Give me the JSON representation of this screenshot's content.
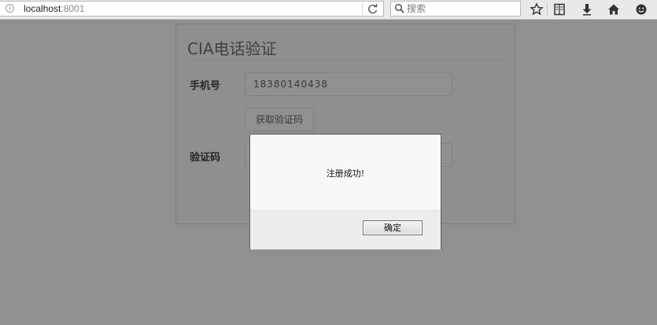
{
  "browser": {
    "url_host": "localhost",
    "url_port": ":8001",
    "search_placeholder": "搜索"
  },
  "page": {
    "title": "CIA电话验证",
    "phone_label": "手机号",
    "phone_value": "18380140438",
    "get_code_button": "获取验证码",
    "code_label": "验证码"
  },
  "dialog": {
    "message": "注册成功!",
    "ok_button": "确定"
  }
}
